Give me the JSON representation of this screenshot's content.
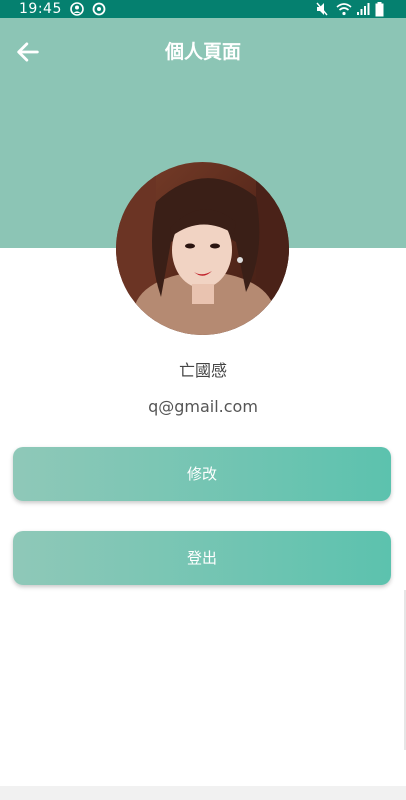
{
  "status_bar": {
    "time": "19:45",
    "left_icons": [
      "account-icon",
      "sync-icon"
    ],
    "right_icons": [
      "mute-icon",
      "wifi-icon",
      "signal-icon",
      "battery-icon"
    ]
  },
  "header": {
    "title": "個人頁面",
    "back_icon": "arrow-left-icon"
  },
  "profile": {
    "name": "亡國感",
    "email": "q@gmail.com"
  },
  "buttons": {
    "edit": "修改",
    "logout": "登出"
  },
  "colors": {
    "status_bar": "#05806f",
    "header": "#8cc5b5",
    "button_gradient_start": "#8fc8b8",
    "button_gradient_end": "#5cc2ae"
  }
}
